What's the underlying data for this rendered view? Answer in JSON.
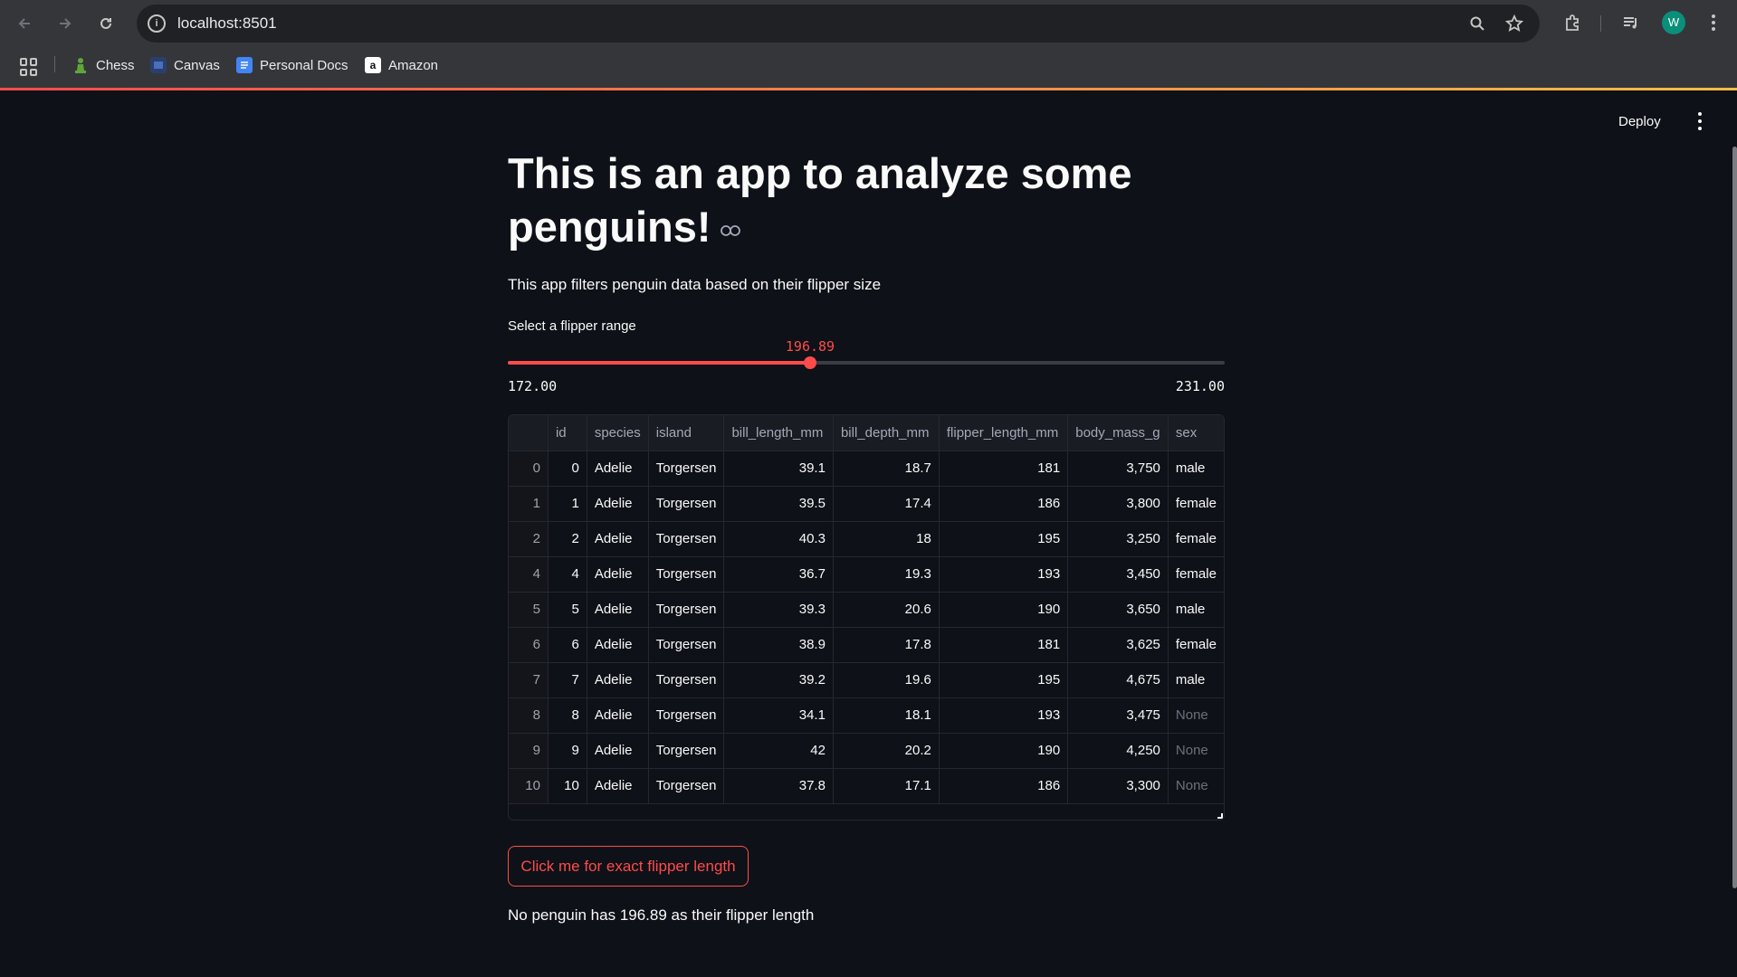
{
  "browser": {
    "url": "localhost:8501",
    "avatar_letter": "W",
    "bookmarks": [
      {
        "label": "Chess",
        "icon": "chess-pawn-icon",
        "color": "#5ea63b"
      },
      {
        "label": "Canvas",
        "icon": "canvas-icon",
        "color": "#3b5aa8"
      },
      {
        "label": "Personal Docs",
        "icon": "docs-icon",
        "color": "#4285f4"
      },
      {
        "label": "Amazon",
        "icon": "amazon-icon",
        "color": "#ffffff"
      }
    ]
  },
  "app": {
    "deploy_label": "Deploy",
    "title": "This is an app to analyze some penguins!",
    "subtitle": "This app filters penguin data based on their flipper size",
    "slider": {
      "label": "Select a flipper range",
      "value": "196.89",
      "min": "172.00",
      "max": "231.00",
      "fraction": 0.4219
    },
    "table": {
      "columns": [
        "",
        "id",
        "species",
        "island",
        "bill_length_mm",
        "bill_depth_mm",
        "flipper_length_mm",
        "body_mass_g",
        "sex"
      ],
      "rows": [
        [
          "0",
          "0",
          "Adelie",
          "Torgersen",
          "39.1",
          "18.7",
          "181",
          "3,750",
          "male"
        ],
        [
          "1",
          "1",
          "Adelie",
          "Torgersen",
          "39.5",
          "17.4",
          "186",
          "3,800",
          "female"
        ],
        [
          "2",
          "2",
          "Adelie",
          "Torgersen",
          "40.3",
          "18",
          "195",
          "3,250",
          "female"
        ],
        [
          "4",
          "4",
          "Adelie",
          "Torgersen",
          "36.7",
          "19.3",
          "193",
          "3,450",
          "female"
        ],
        [
          "5",
          "5",
          "Adelie",
          "Torgersen",
          "39.3",
          "20.6",
          "190",
          "3,650",
          "male"
        ],
        [
          "6",
          "6",
          "Adelie",
          "Torgersen",
          "38.9",
          "17.8",
          "181",
          "3,625",
          "female"
        ],
        [
          "7",
          "7",
          "Adelie",
          "Torgersen",
          "39.2",
          "19.6",
          "195",
          "4,675",
          "male"
        ],
        [
          "8",
          "8",
          "Adelie",
          "Torgersen",
          "34.1",
          "18.1",
          "193",
          "3,475",
          "None"
        ],
        [
          "9",
          "9",
          "Adelie",
          "Torgersen",
          "42",
          "20.2",
          "190",
          "4,250",
          "None"
        ],
        [
          "10",
          "10",
          "Adelie",
          "Torgersen",
          "37.8",
          "17.1",
          "186",
          "3,300",
          "None"
        ]
      ]
    },
    "button_label": "Click me for exact flipper length",
    "result_text": "No penguin has 196.89 as their flipper length"
  },
  "colors": {
    "accent": "#ff4b4b",
    "background": "#0e1117"
  }
}
